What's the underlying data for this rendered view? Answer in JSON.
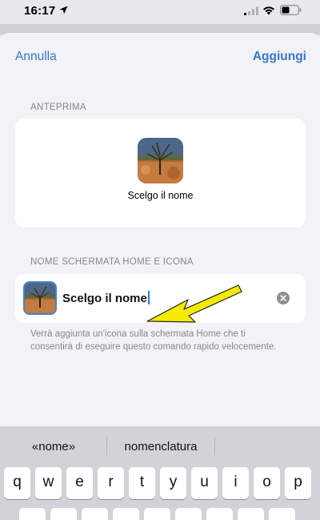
{
  "status_bar": {
    "time": "16:17"
  },
  "nav": {
    "cancel_label": "Annulla",
    "add_label": "Aggiungi"
  },
  "preview": {
    "section_title": "ANTEPRIMA",
    "shortcut_name": "Scelgo il nome"
  },
  "home_screen": {
    "section_title": "NOME SCHERMATA HOME E ICONA",
    "name_value": "Scelgo il nome",
    "hint": "Verrà aggiunta un'icona sulla schermata Home che ti consentirà di eseguire questo comando rapido velocemente."
  },
  "keyboard": {
    "suggestions": [
      "«nome»",
      "nomenclatura"
    ],
    "row1": [
      "q",
      "w",
      "e",
      "r",
      "t",
      "y",
      "u",
      "i",
      "o",
      "p"
    ]
  },
  "colors": {
    "accent": "#3478c9",
    "arrow": "#f5ea00"
  },
  "icons": [
    "location-arrow-icon",
    "signal-icon",
    "wifi-icon",
    "battery-icon",
    "clear-icon",
    "arrow-annotation"
  ]
}
